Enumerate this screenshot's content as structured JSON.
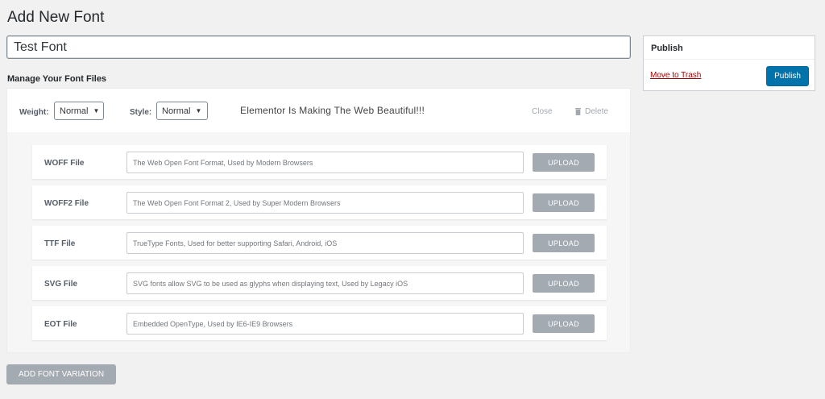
{
  "page": {
    "title": "Add New Font"
  },
  "font_name": {
    "value": "Test Font"
  },
  "manage": {
    "heading": "Manage Your Font Files"
  },
  "variation": {
    "weight_label": "Weight:",
    "weight_value": "Normal",
    "style_label": "Style:",
    "style_value": "Normal",
    "preview_text": "Elementor Is Making The Web Beautiful!!!",
    "close_label": "Close",
    "delete_label": "Delete",
    "files": [
      {
        "label": "WOFF File",
        "placeholder": "The Web Open Font Format, Used by Modern Browsers",
        "button": "UPLOAD"
      },
      {
        "label": "WOFF2 File",
        "placeholder": "The Web Open Font Format 2, Used by Super Modern Browsers",
        "button": "UPLOAD"
      },
      {
        "label": "TTF File",
        "placeholder": "TrueType Fonts, Used for better supporting Safari, Android, iOS",
        "button": "UPLOAD"
      },
      {
        "label": "SVG File",
        "placeholder": "SVG fonts allow SVG to be used as glyphs when displaying text, Used by Legacy iOS",
        "button": "UPLOAD"
      },
      {
        "label": "EOT File",
        "placeholder": "Embedded OpenType, Used by IE6-IE9 Browsers",
        "button": "UPLOAD"
      }
    ]
  },
  "add_variation": {
    "label": "ADD FONT VARIATION"
  },
  "publish": {
    "title": "Publish",
    "trash_label": "Move to Trash",
    "button_label": "Publish"
  },
  "icons": {
    "delete": "trash-icon",
    "select": "chevron-down-icon"
  },
  "colors": {
    "primary": "#0073aa",
    "trash_link": "#a00000",
    "upload_button": "#a3aab2"
  }
}
